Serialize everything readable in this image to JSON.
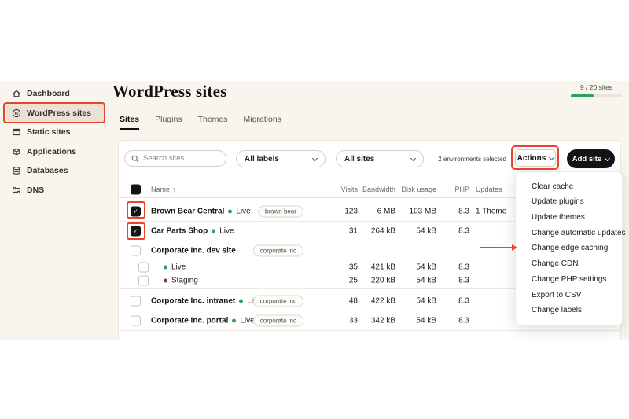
{
  "sidebar": {
    "items": [
      {
        "label": "Dashboard",
        "icon": "home-icon",
        "selected": false
      },
      {
        "label": "WordPress sites",
        "icon": "wordpress-icon",
        "selected": true
      },
      {
        "label": "Static sites",
        "icon": "browser-icon",
        "selected": false
      },
      {
        "label": "Applications",
        "icon": "package-icon",
        "selected": false
      },
      {
        "label": "Databases",
        "icon": "database-icon",
        "selected": false
      },
      {
        "label": "DNS",
        "icon": "dns-icon",
        "selected": false
      }
    ]
  },
  "header": {
    "title": "WordPress sites",
    "usage": {
      "label": "9 / 20 sites",
      "used": 9,
      "total": 20
    },
    "tabs": [
      {
        "label": "Sites",
        "active": true
      },
      {
        "label": "Plugins",
        "active": false
      },
      {
        "label": "Themes",
        "active": false
      },
      {
        "label": "Migrations",
        "active": false
      }
    ]
  },
  "toolbar": {
    "search_placeholder": "Search sites",
    "labels_filter_value": "All labels",
    "sites_filter_value": "All sites",
    "selection_status": "2 environments selected",
    "actions_button": "Actions",
    "add_site_button": "Add site"
  },
  "table": {
    "sort_arrow": "↑",
    "columns": {
      "name": "Name",
      "visits": "Visits",
      "bandwidth": "Bandwidth",
      "disk_usage": "Disk usage",
      "php": "PHP",
      "updates": "Updates"
    },
    "rows": [
      {
        "name": "Brown Bear Central",
        "environment": "Live",
        "status": "live",
        "label": "brown bear",
        "visits": "123",
        "bandwidth": "6 MB",
        "disk_usage": "103 MB",
        "php": "8.3",
        "updates": "1 Theme",
        "checked": true
      },
      {
        "name": "Car Parts Shop",
        "environment": "Live",
        "status": "live",
        "visits": "31",
        "bandwidth": "264 kB",
        "disk_usage": "54 kB",
        "php": "8.3",
        "checked": true
      },
      {
        "name": "Corporate Inc. dev site",
        "label": "corporate inc",
        "checked": false,
        "children": [
          {
            "environment": "Live",
            "status": "live",
            "visits": "35",
            "bandwidth": "421 kB",
            "disk_usage": "54 kB",
            "php": "8.3",
            "checked": false
          },
          {
            "environment": "Staging",
            "status": "staging",
            "visits": "25",
            "bandwidth": "220 kB",
            "disk_usage": "54 kB",
            "php": "8.3",
            "checked": false
          }
        ]
      },
      {
        "name": "Corporate Inc. intranet",
        "environment": "Live",
        "status": "live",
        "label": "corporate inc",
        "visits": "48",
        "bandwidth": "422 kB",
        "disk_usage": "54 kB",
        "php": "8.3",
        "checked": false
      },
      {
        "name": "Corporate Inc. portal",
        "environment": "Live",
        "status": "live",
        "label": "corporate inc",
        "visits": "33",
        "bandwidth": "342 kB",
        "disk_usage": "54 kB",
        "php": "8.3",
        "checked": false
      }
    ]
  },
  "actions_menu": {
    "items": [
      "Clear cache",
      "Update plugins",
      "Update themes",
      "Change automatic updates",
      "Change edge caching",
      "Change CDN",
      "Change PHP settings",
      "Export to CSV",
      "Change labels"
    ]
  },
  "annotations": {
    "accent_color": "#e8432c",
    "boxed_elements": [
      "WordPress sites nav item",
      "Brown Bear Central checkbox",
      "Car Parts Shop checkbox",
      "Actions button"
    ],
    "arrow_points_to": "Change edge caching"
  },
  "colors": {
    "background": "#f8f4ee",
    "card": "#ffffff",
    "accent_red": "#e8432c",
    "live_green": "#2e9e58",
    "staging_maroon": "#7d403c",
    "button_black": "#141414",
    "progress_green": "#2c9f5f"
  }
}
